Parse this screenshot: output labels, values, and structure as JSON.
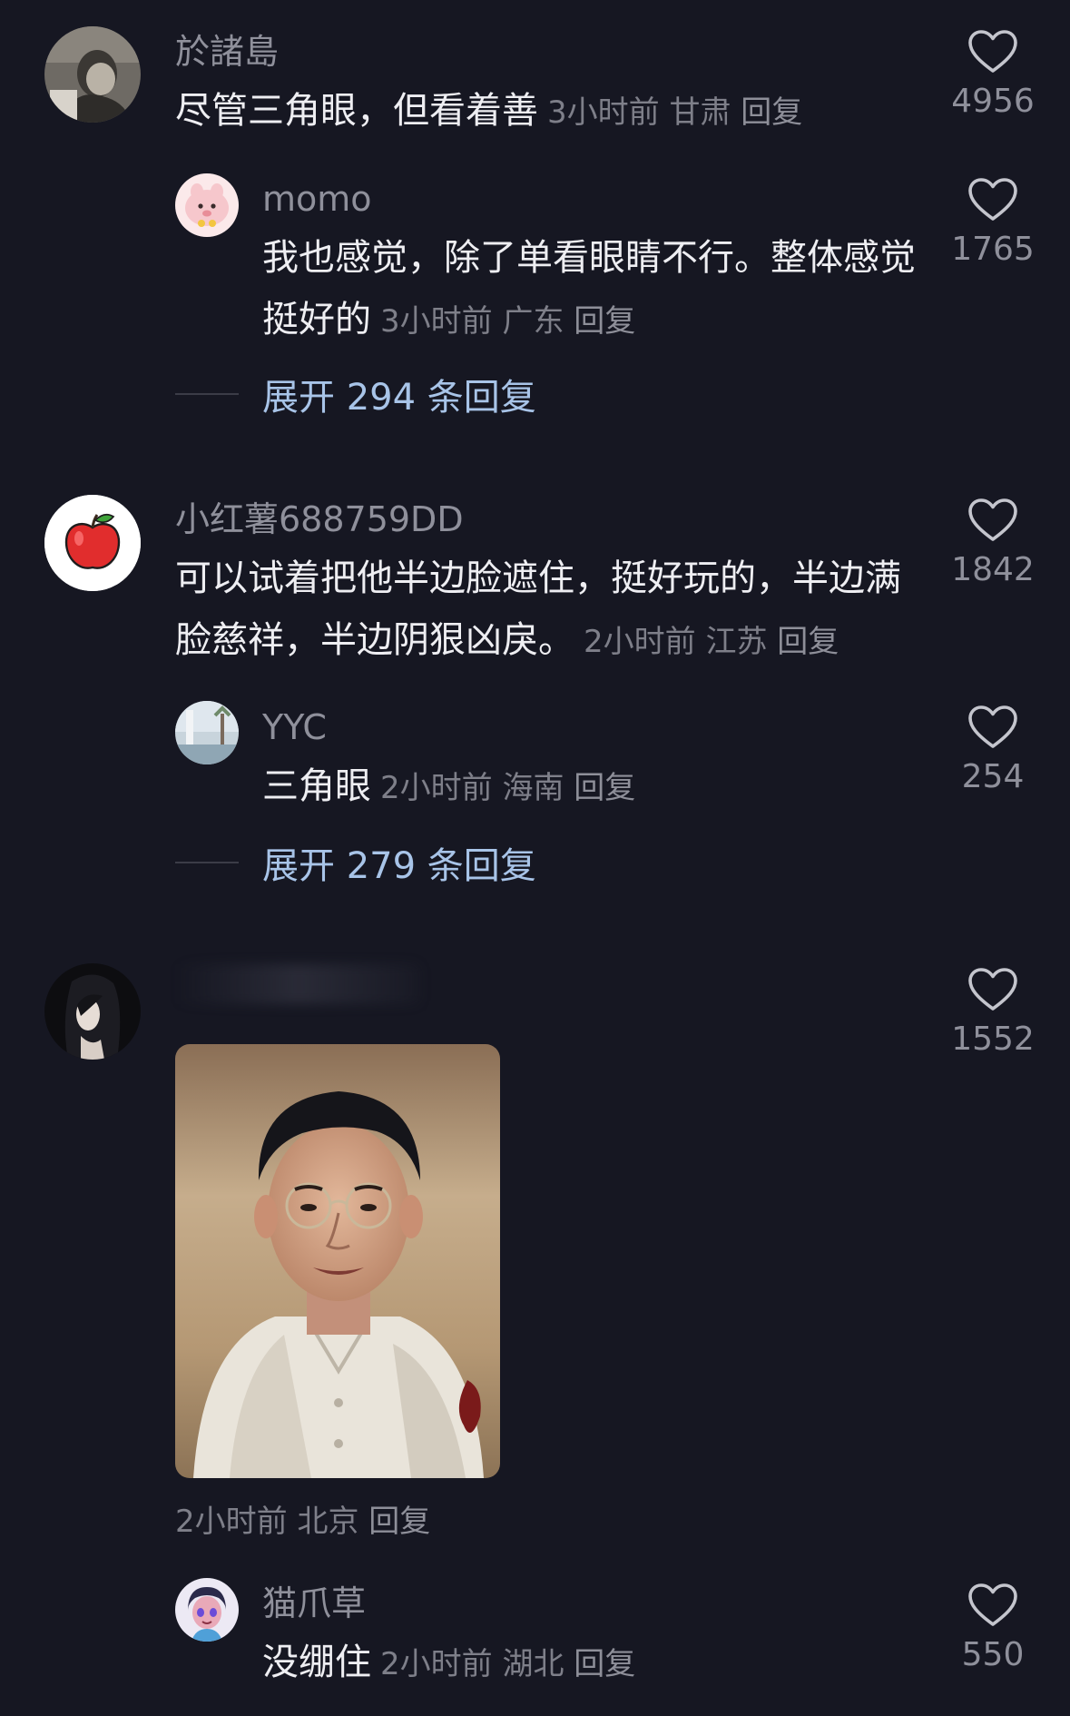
{
  "colors": {
    "background": "#161722",
    "username": "#8f909b",
    "comment_text": "#eeeef2",
    "meta": "#7e7f89",
    "expand_link": "#a8c4e8"
  },
  "comments": [
    {
      "username": "於諸島",
      "text": "尽管三角眼，但看着善",
      "time": "3小时前",
      "location": "甘肃",
      "reply": "回复",
      "likes": "4956",
      "avatar_icon": "person-photo-avatar"
    },
    {
      "username": "小红薯688759DD",
      "text": "可以试着把他半边脸遮住，挺好玩的，半边满脸慈祥，半边阴狠凶戾。",
      "time": "2小时前",
      "location": "江苏",
      "reply": "回复",
      "likes": "1842",
      "avatar_icon": "apple-avatar"
    },
    {
      "username": "",
      "text": "",
      "time": "2小时前",
      "location": "北京",
      "reply": "回复",
      "likes": "1552",
      "avatar_icon": "woman-long-hair-avatar",
      "image": "photo-man-with-glasses"
    }
  ],
  "replies": [
    {
      "username": "momo",
      "text": "我也感觉，除了单看眼睛不行。整体感觉挺好的",
      "time": "3小时前",
      "location": "广东",
      "reply": "回复",
      "likes": "1765",
      "avatar_icon": "pink-cartoon-avatar"
    },
    {
      "username": "YYC",
      "text": "三角眼",
      "time": "2小时前",
      "location": "海南",
      "reply": "回复",
      "likes": "254",
      "avatar_icon": "landscape-avatar"
    },
    {
      "username": "猫爪草",
      "text": "没绷住",
      "time": "2小时前",
      "location": "湖北",
      "reply": "回复",
      "likes": "550",
      "avatar_icon": "cartoon-girl-avatar"
    }
  ],
  "expand_links": [
    "展开 294 条回复",
    "展开 279 条回复"
  ]
}
